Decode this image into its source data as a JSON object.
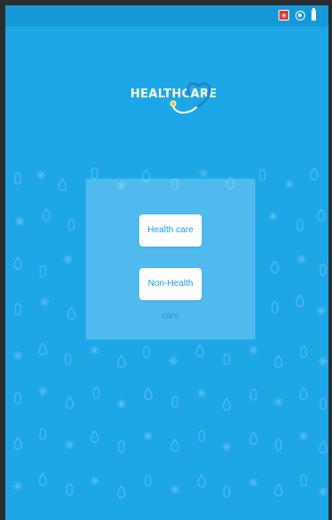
{
  "app": {
    "logo_text": "HEALTHCARE",
    "background_color": "#1ea7e8",
    "status_bar_color": "#1599d6",
    "accent_red": "#e74c3c"
  },
  "status_bar": {
    "icons": [
      "notification-icon",
      "sync-icon",
      "battery-icon"
    ]
  },
  "menu": {
    "health_care_label": "Health care",
    "non_health_care_label": "Non-Health care"
  }
}
